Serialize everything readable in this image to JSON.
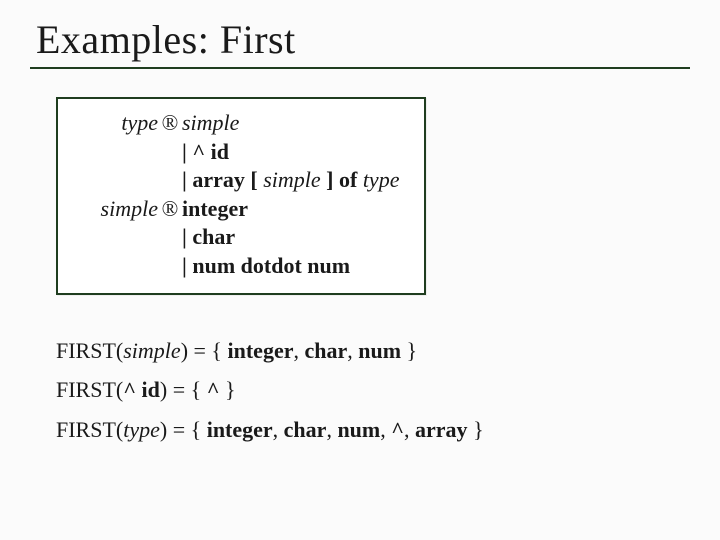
{
  "title": "Examples: First",
  "arrow": "®",
  "grammar": {
    "r1_lhs": "type",
    "r1_rhs": "simple",
    "r2_rhs": "| ^ id",
    "r3_rhs_a": "| array [ ",
    "r3_rhs_b": "simple",
    "r3_rhs_c": " ] of ",
    "r3_rhs_d": "type",
    "r4_lhs": "simple",
    "r4_rhs": "integer",
    "r5_rhs": "| char",
    "r6_rhs": "| num dotdot num"
  },
  "first": {
    "line1_a": "FIRST(",
    "line1_b": "simple",
    "line1_c": ") = { ",
    "line1_d": "integer",
    "line1_e": ", ",
    "line1_f": "char",
    "line1_g": ", ",
    "line1_h": "num",
    "line1_i": " }",
    "line2_a": "FIRST(",
    "line2_b": "^ id",
    "line2_c": ") = { ",
    "line2_d": "^",
    "line2_e": " }",
    "line3_a": "FIRST(",
    "line3_b": "type",
    "line3_c": ") = { ",
    "line3_d": "integer",
    "line3_e": ", ",
    "line3_f": "char",
    "line3_g": ", ",
    "line3_h": "num",
    "line3_i": ", ",
    "line3_j": "^",
    "line3_k": ", ",
    "line3_l": "array",
    "line3_m": " }"
  }
}
